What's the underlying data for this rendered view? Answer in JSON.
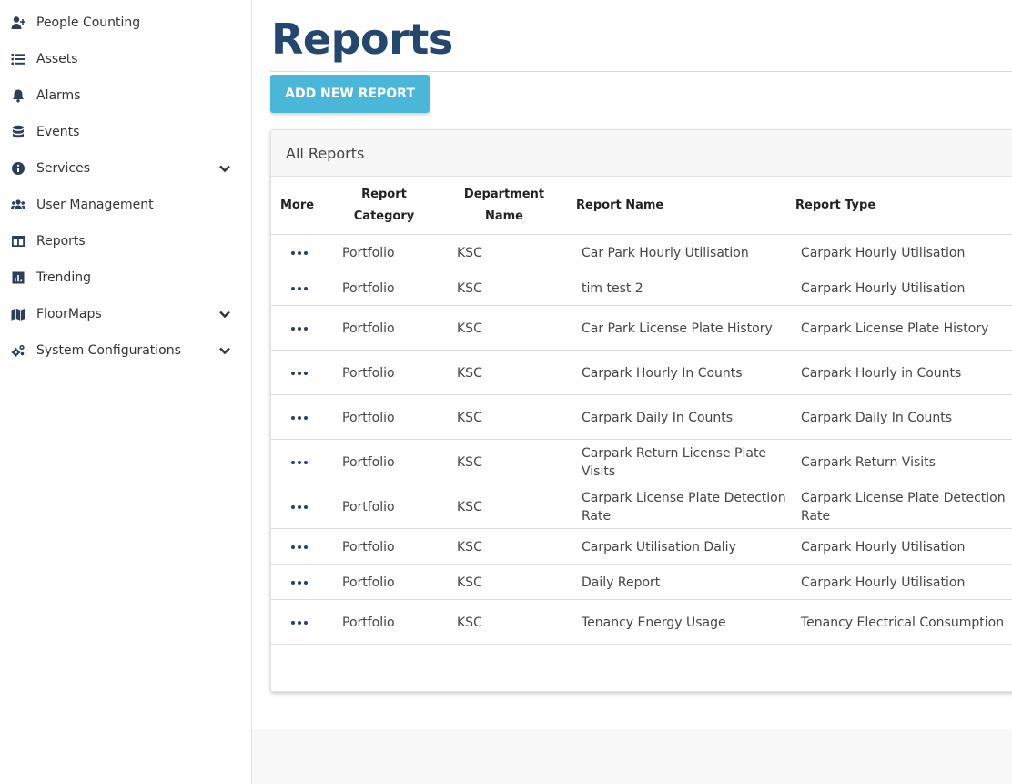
{
  "sidebar": {
    "items": [
      {
        "label": "People Counting",
        "icon": "user-plus-icon"
      },
      {
        "label": "Assets",
        "icon": "list-icon"
      },
      {
        "label": "Alarms",
        "icon": "bell-icon"
      },
      {
        "label": "Events",
        "icon": "database-icon"
      },
      {
        "label": "Services",
        "icon": "info-icon",
        "expandable": true
      },
      {
        "label": "User Management",
        "icon": "users-icon"
      },
      {
        "label": "Reports",
        "icon": "table-icon"
      },
      {
        "label": "Trending",
        "icon": "chart-icon"
      },
      {
        "label": "FloorMaps",
        "icon": "map-icon",
        "expandable": true
      },
      {
        "label": "System Configurations",
        "icon": "cogs-icon",
        "expandable": true
      }
    ]
  },
  "page": {
    "title": "Reports",
    "add_button_label": "ADD NEW REPORT"
  },
  "card": {
    "title": "All Reports"
  },
  "table": {
    "headers": {
      "more": "More",
      "category_line1": "Report",
      "category_line2": "Category",
      "department_line1": "Department",
      "department_line2": "Name",
      "report_name": "Report Name",
      "report_type": "Report Type"
    },
    "rows": [
      {
        "category": "Portfolio",
        "department": "KSC",
        "name": "Car Park Hourly Utilisation",
        "type": "Carpark Hourly Utilisation"
      },
      {
        "category": "Portfolio",
        "department": "KSC",
        "name": "tim test 2",
        "type": "Carpark Hourly Utilisation"
      },
      {
        "category": "Portfolio",
        "department": "KSC",
        "name": "Car Park License Plate History",
        "type": "Carpark License Plate History"
      },
      {
        "category": "Portfolio",
        "department": "KSC",
        "name": "Carpark Hourly In Counts",
        "type": "Carpark Hourly in Counts"
      },
      {
        "category": "Portfolio",
        "department": "KSC",
        "name": "Carpark Daily In Counts",
        "type": "Carpark Daily In Counts"
      },
      {
        "category": "Portfolio",
        "department": "KSC",
        "name": "Carpark Return License Plate Visits",
        "type": "Carpark Return Visits"
      },
      {
        "category": "Portfolio",
        "department": "KSC",
        "name": "Carpark License Plate Detection Rate",
        "type": "Carpark License Plate Detection Rate"
      },
      {
        "category": "Portfolio",
        "department": "KSC",
        "name": "Carpark Utilisation Daliy",
        "type": "Carpark Hourly Utilisation"
      },
      {
        "category": "Portfolio",
        "department": "KSC",
        "name": "Daily Report",
        "type": "Carpark Hourly Utilisation"
      },
      {
        "category": "Portfolio",
        "department": "KSC",
        "name": "Tenancy Energy Usage",
        "type": "Tenancy Electrical Consumption"
      }
    ]
  },
  "colors": {
    "title": "#23476e",
    "button": "#4ab7d9",
    "icon": "#2c3e5c"
  }
}
